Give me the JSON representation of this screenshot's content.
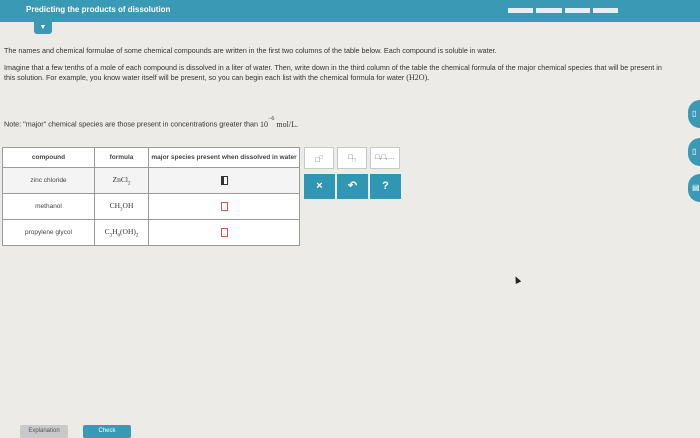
{
  "header": {
    "title": "Predicting the products of dissolution",
    "progress_segments": 4,
    "collapse_icon": "chevron-down-icon"
  },
  "instructions": {
    "p1": "The names and chemical formulae of some chemical compounds are written in the first two columns of the table below. Each compound is soluble in water.",
    "p2_a": "Imagine that a few tenths of a mole of each compound is dissolved in a liter of water. Then, write down in the third column of the table the chemical formula of the major chemical species that will be present in this solution. For example, you know water itself will be present, so you can begin each list with the chemical formula for water",
    "p2_formula": "(H2O).",
    "note_prefix": "Note: \"major\" chemical species are those present in concentrations greater than",
    "note_base": "10",
    "note_exp": "−6",
    "note_unit": "mol/L."
  },
  "table": {
    "headers": [
      "compound",
      "formula",
      "major species present when dissolved in water"
    ],
    "rows": [
      {
        "compound": "zinc chloride",
        "formula": "ZnCl2"
      },
      {
        "compound": "methanol",
        "formula": "CH3OH"
      },
      {
        "compound": "propylene glycol",
        "formula": "C3H6(OH)2"
      }
    ]
  },
  "palette": {
    "superscript_icon": "superscript-box-icon",
    "subscript_icon": "subscript-box-icon",
    "list_label": "□,□,…",
    "clear_label": "×",
    "undo_icon": "undo-icon",
    "help_label": "?"
  },
  "footer": {
    "explanation_label": "Explanation",
    "check_label": "Check"
  },
  "colors": {
    "accent": "#3a9ab5",
    "input_border": "#d9534f"
  }
}
